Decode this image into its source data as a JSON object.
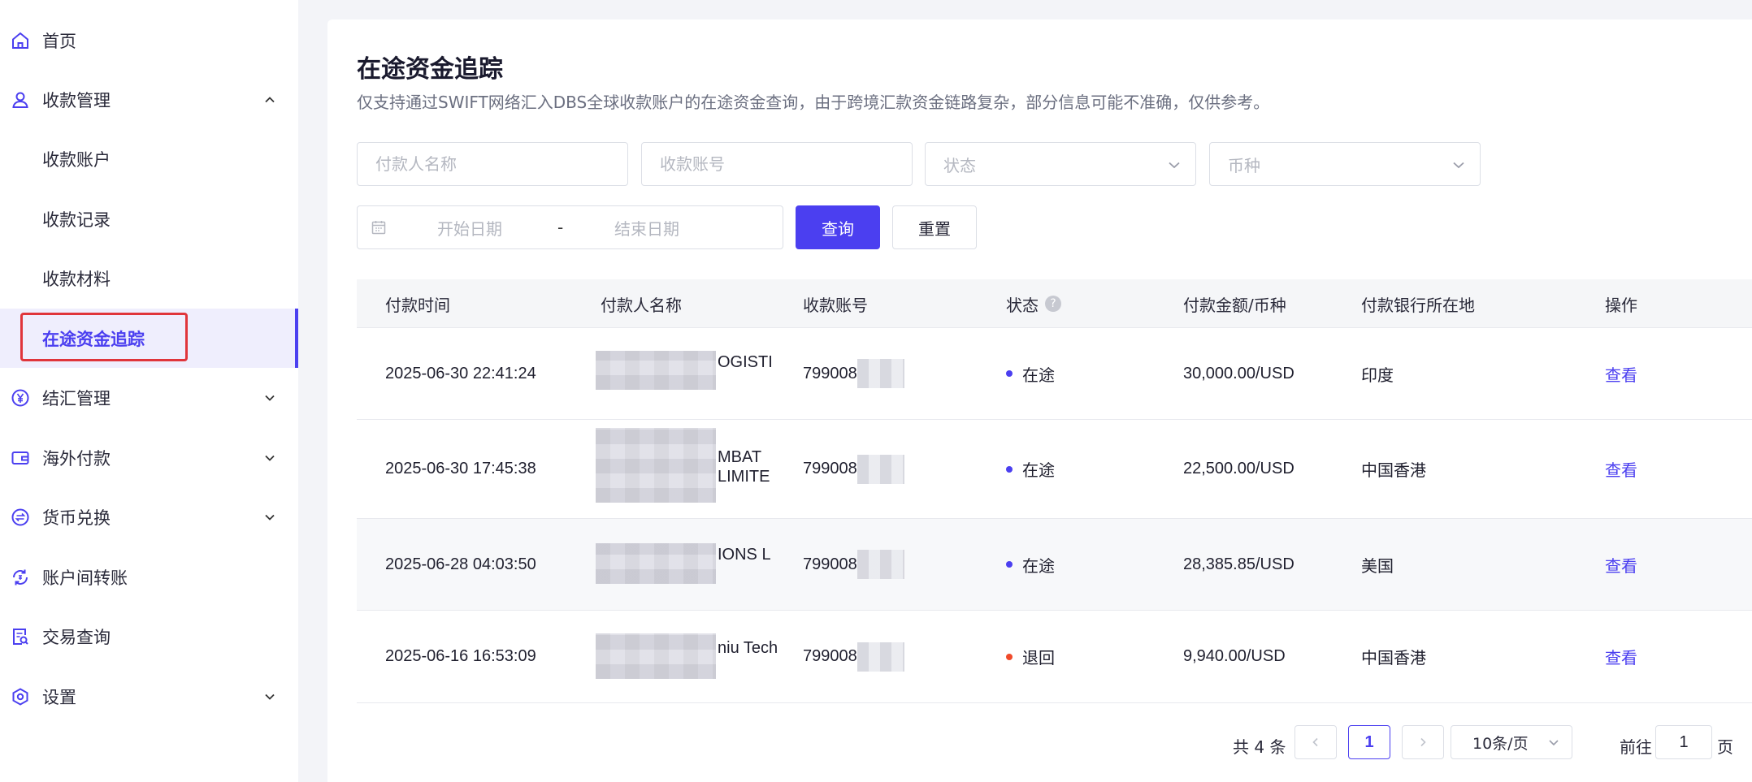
{
  "sidebar": {
    "items": [
      {
        "label": "首页",
        "icon": "home-icon"
      },
      {
        "label": "收款管理",
        "icon": "user-icon",
        "expanded": true
      },
      {
        "label": "收款账户"
      },
      {
        "label": "收款记录"
      },
      {
        "label": "收款材料"
      },
      {
        "label": "在途资金追踪",
        "active": true
      },
      {
        "label": "结汇管理",
        "icon": "yen-icon"
      },
      {
        "label": "海外付款",
        "icon": "wallet-icon"
      },
      {
        "label": "货币兑换",
        "icon": "exchange-icon"
      },
      {
        "label": "账户间转账",
        "icon": "transfer-icon"
      },
      {
        "label": "交易查询",
        "icon": "search-record-icon"
      },
      {
        "label": "设置",
        "icon": "settings-icon"
      }
    ]
  },
  "page": {
    "title": "在途资金追踪",
    "description": "仅支持通过SWIFT网络汇入DBS全球收款账户的在途资金查询，由于跨境汇款资金链路复杂，部分信息可能不准确，仅供参考。"
  },
  "filters": {
    "payer_placeholder": "付款人名称",
    "account_placeholder": "收款账号",
    "status_placeholder": "状态",
    "currency_placeholder": "币种",
    "start_date_placeholder": "开始日期",
    "date_separator": "-",
    "end_date_placeholder": "结束日期",
    "query_label": "查询",
    "reset_label": "重置"
  },
  "table": {
    "headers": {
      "time": "付款时间",
      "payer": "付款人名称",
      "account": "收款账号",
      "status": "状态",
      "status_help": "?",
      "amount": "付款金额/币种",
      "bank_location": "付款银行所在地",
      "action": "操作"
    },
    "rows": [
      {
        "time": "2025-06-30 22:41:24",
        "payer": "OGISTI",
        "account": "799008",
        "status": "在途",
        "status_color": "#4b3ff0",
        "amount": "30,000.00/USD",
        "location": "印度",
        "action": "查看"
      },
      {
        "time": "2025-06-30 17:45:38",
        "payer": "MBAT\nLIMITE",
        "account": "799008",
        "status": "在途",
        "status_color": "#4b3ff0",
        "amount": "22,500.00/USD",
        "location": "中国香港",
        "action": "查看"
      },
      {
        "time": "2025-06-28 04:03:50",
        "payer": "IONS L",
        "account": "799008",
        "status": "在途",
        "status_color": "#4b3ff0",
        "amount": "28,385.85/USD",
        "location": "美国",
        "action": "查看"
      },
      {
        "time": "2025-06-16 16:53:09",
        "payer": "niu Tech",
        "account": "799008",
        "status": "退回",
        "status_color": "#f04a2a",
        "amount": "9,940.00/USD",
        "location": "中国香港",
        "action": "查看"
      }
    ]
  },
  "pagination": {
    "total": "共 4 条",
    "current_page": "1",
    "page_size": "10条/页",
    "goto_prefix": "前往",
    "goto_value": "1",
    "goto_suffix": "页"
  }
}
